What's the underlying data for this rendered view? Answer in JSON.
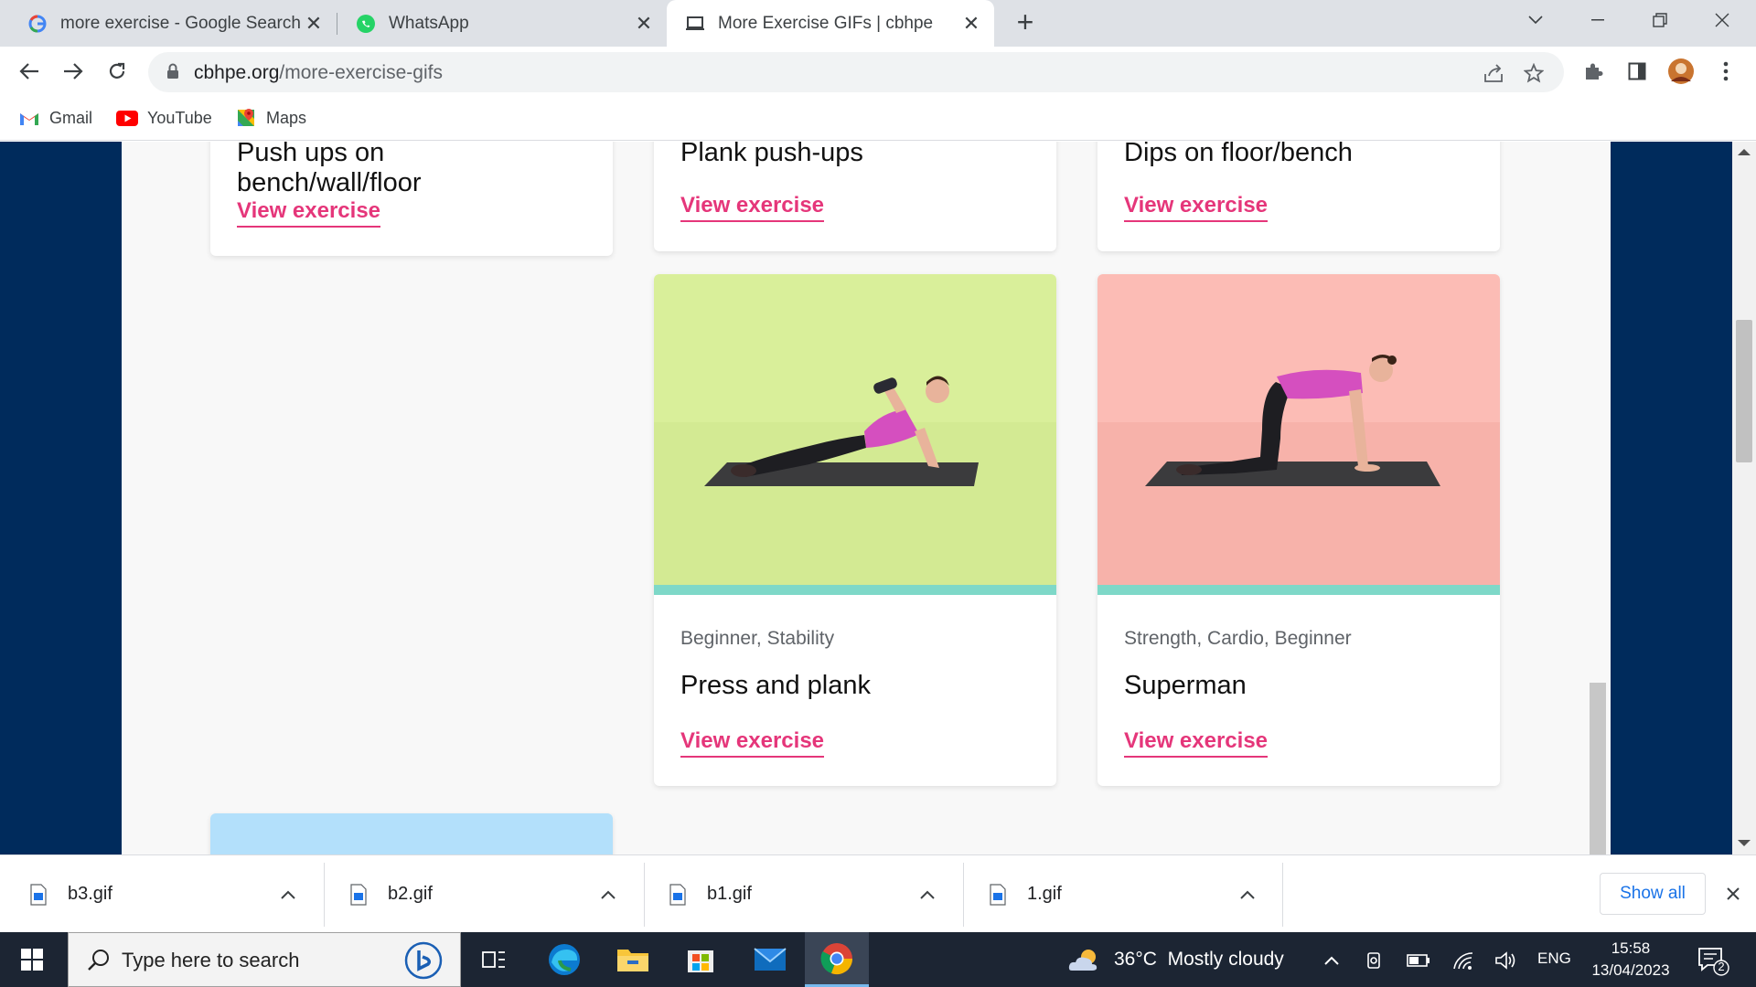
{
  "browser": {
    "tabs": [
      {
        "title": "more exercise - Google Search",
        "icon": "google-icon"
      },
      {
        "title": "WhatsApp",
        "icon": "whatsapp-icon"
      },
      {
        "title": "More Exercise GIFs | cbhpe",
        "icon": "laptop-icon",
        "active": true
      }
    ],
    "url": {
      "domain": "cbhpe.org",
      "path": "/more-exercise-gifs"
    },
    "bookmarks": [
      {
        "label": "Gmail",
        "icon": "gmail-icon"
      },
      {
        "label": "YouTube",
        "icon": "youtube-icon"
      },
      {
        "label": "Maps",
        "icon": "maps-icon"
      }
    ]
  },
  "cards": {
    "c1": {
      "title": "Push ups on bench/wall/floor",
      "link": "View exercise"
    },
    "c2": {
      "title": "Plank push-ups",
      "link": "View exercise"
    },
    "c3": {
      "title": "Dips on floor/bench",
      "link": "View exercise"
    },
    "c4": {
      "tags": "Beginner, Stability",
      "title": "Press and plank",
      "link": "View exercise",
      "image_bg": "#d9ef9a"
    },
    "c5": {
      "tags": "Strength, Cardio, Beginner",
      "title": "Superman",
      "link": "View exercise",
      "image_bg": "#fcbcb5"
    }
  },
  "downloads": {
    "files": [
      "b3.gif",
      "b2.gif",
      "b1.gif",
      "1.gif"
    ],
    "show_all": "Show all"
  },
  "taskbar": {
    "search_placeholder": "Type here to search",
    "weather": "36°C  Mostly cloudy",
    "language": "ENG",
    "time": "15:58",
    "date": "13/04/2023",
    "notifications": "2"
  },
  "colors": {
    "accent_link": "#e5367a",
    "page_frame": "#002b5c",
    "teal_bar": "#7ed8c8"
  }
}
